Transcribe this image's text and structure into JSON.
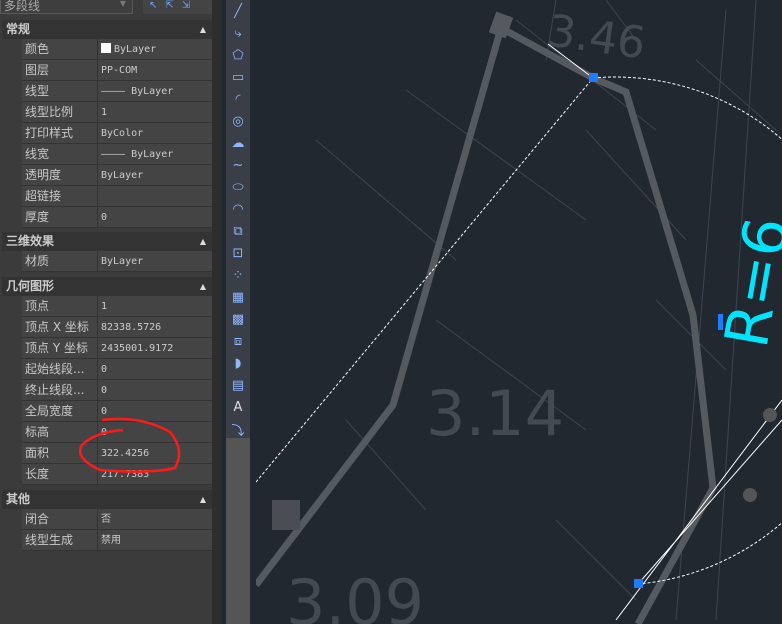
{
  "dropdown": {
    "value": "多段线"
  },
  "sections": [
    {
      "title": "常规",
      "rows": [
        {
          "label": "颜色",
          "value": "ByLayer",
          "swatch": "#ffffff"
        },
        {
          "label": "图层",
          "value": "PP-COM"
        },
        {
          "label": "线型",
          "value": "———— ByLayer"
        },
        {
          "label": "线型比例",
          "value": "1"
        },
        {
          "label": "打印样式",
          "value": "ByColor"
        },
        {
          "label": "线宽",
          "value": "———— ByLayer"
        },
        {
          "label": "透明度",
          "value": "ByLayer"
        },
        {
          "label": "超链接",
          "value": ""
        },
        {
          "label": "厚度",
          "value": "0"
        }
      ]
    },
    {
      "title": "三维效果",
      "rows": [
        {
          "label": "材质",
          "value": "ByLayer"
        }
      ]
    },
    {
      "title": "几何图形",
      "rows": [
        {
          "label": "顶点",
          "value": "1"
        },
        {
          "label": "顶点 X 坐标",
          "value": "82338.5726"
        },
        {
          "label": "顶点 Y 坐标",
          "value": "2435001.9172"
        },
        {
          "label": "起始线段...",
          "value": "0"
        },
        {
          "label": "终止线段...",
          "value": "0"
        },
        {
          "label": "全局宽度",
          "value": "0"
        },
        {
          "label": "标高",
          "value": "0"
        },
        {
          "label": "面积",
          "value": "322.4256"
        },
        {
          "label": "长度",
          "value": "217.7383"
        }
      ]
    },
    {
      "title": "其他",
      "rows": [
        {
          "label": "闭合",
          "value": "否"
        },
        {
          "label": "线型生成",
          "value": "禁用"
        }
      ]
    }
  ],
  "toolbar": [
    "line",
    "polyline",
    "polygon",
    "rectangle",
    "arc",
    "circle",
    "revision-cloud",
    "spline",
    "ellipse",
    "ellipse-arc",
    "insert-block",
    "make-block",
    "point",
    "hatch",
    "gradient",
    "region",
    "wipeout",
    "table",
    "multiline-text",
    "add-selected"
  ],
  "canvas": {
    "labels": [
      "3.46",
      "3.14",
      "3.09"
    ],
    "annotation": "R=6",
    "accent": "#00e5ff",
    "highlight": "#ff1a1a"
  }
}
